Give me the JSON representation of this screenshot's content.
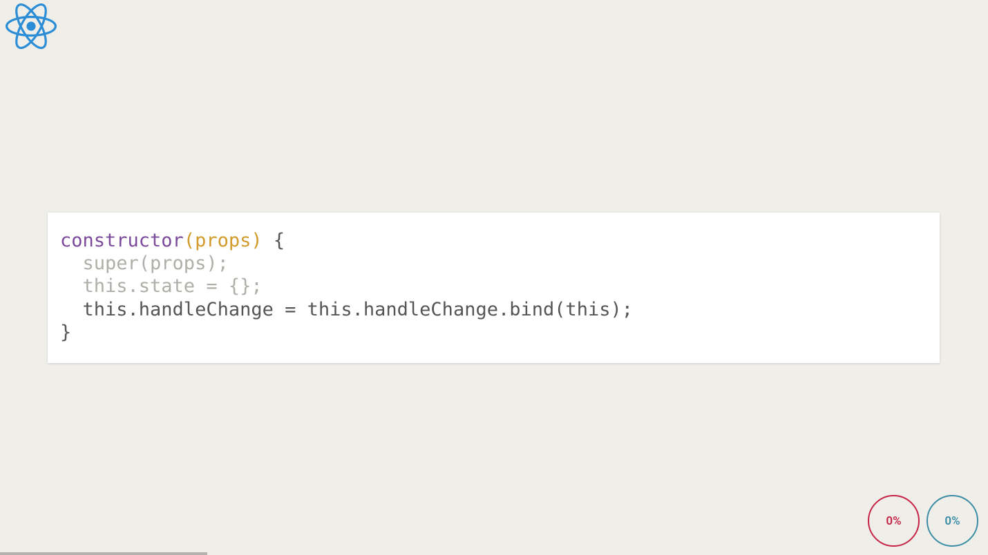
{
  "code": {
    "line1_kw": "constructor",
    "line1_paren": "(props)",
    "line1_brace": " {",
    "line2": "  super(props);",
    "line3": "  this.state = {};",
    "line4": "  this.handleChange = this.handleChange.bind(this);",
    "line5": "}"
  },
  "progress": {
    "left": "0%",
    "right": "0%"
  }
}
